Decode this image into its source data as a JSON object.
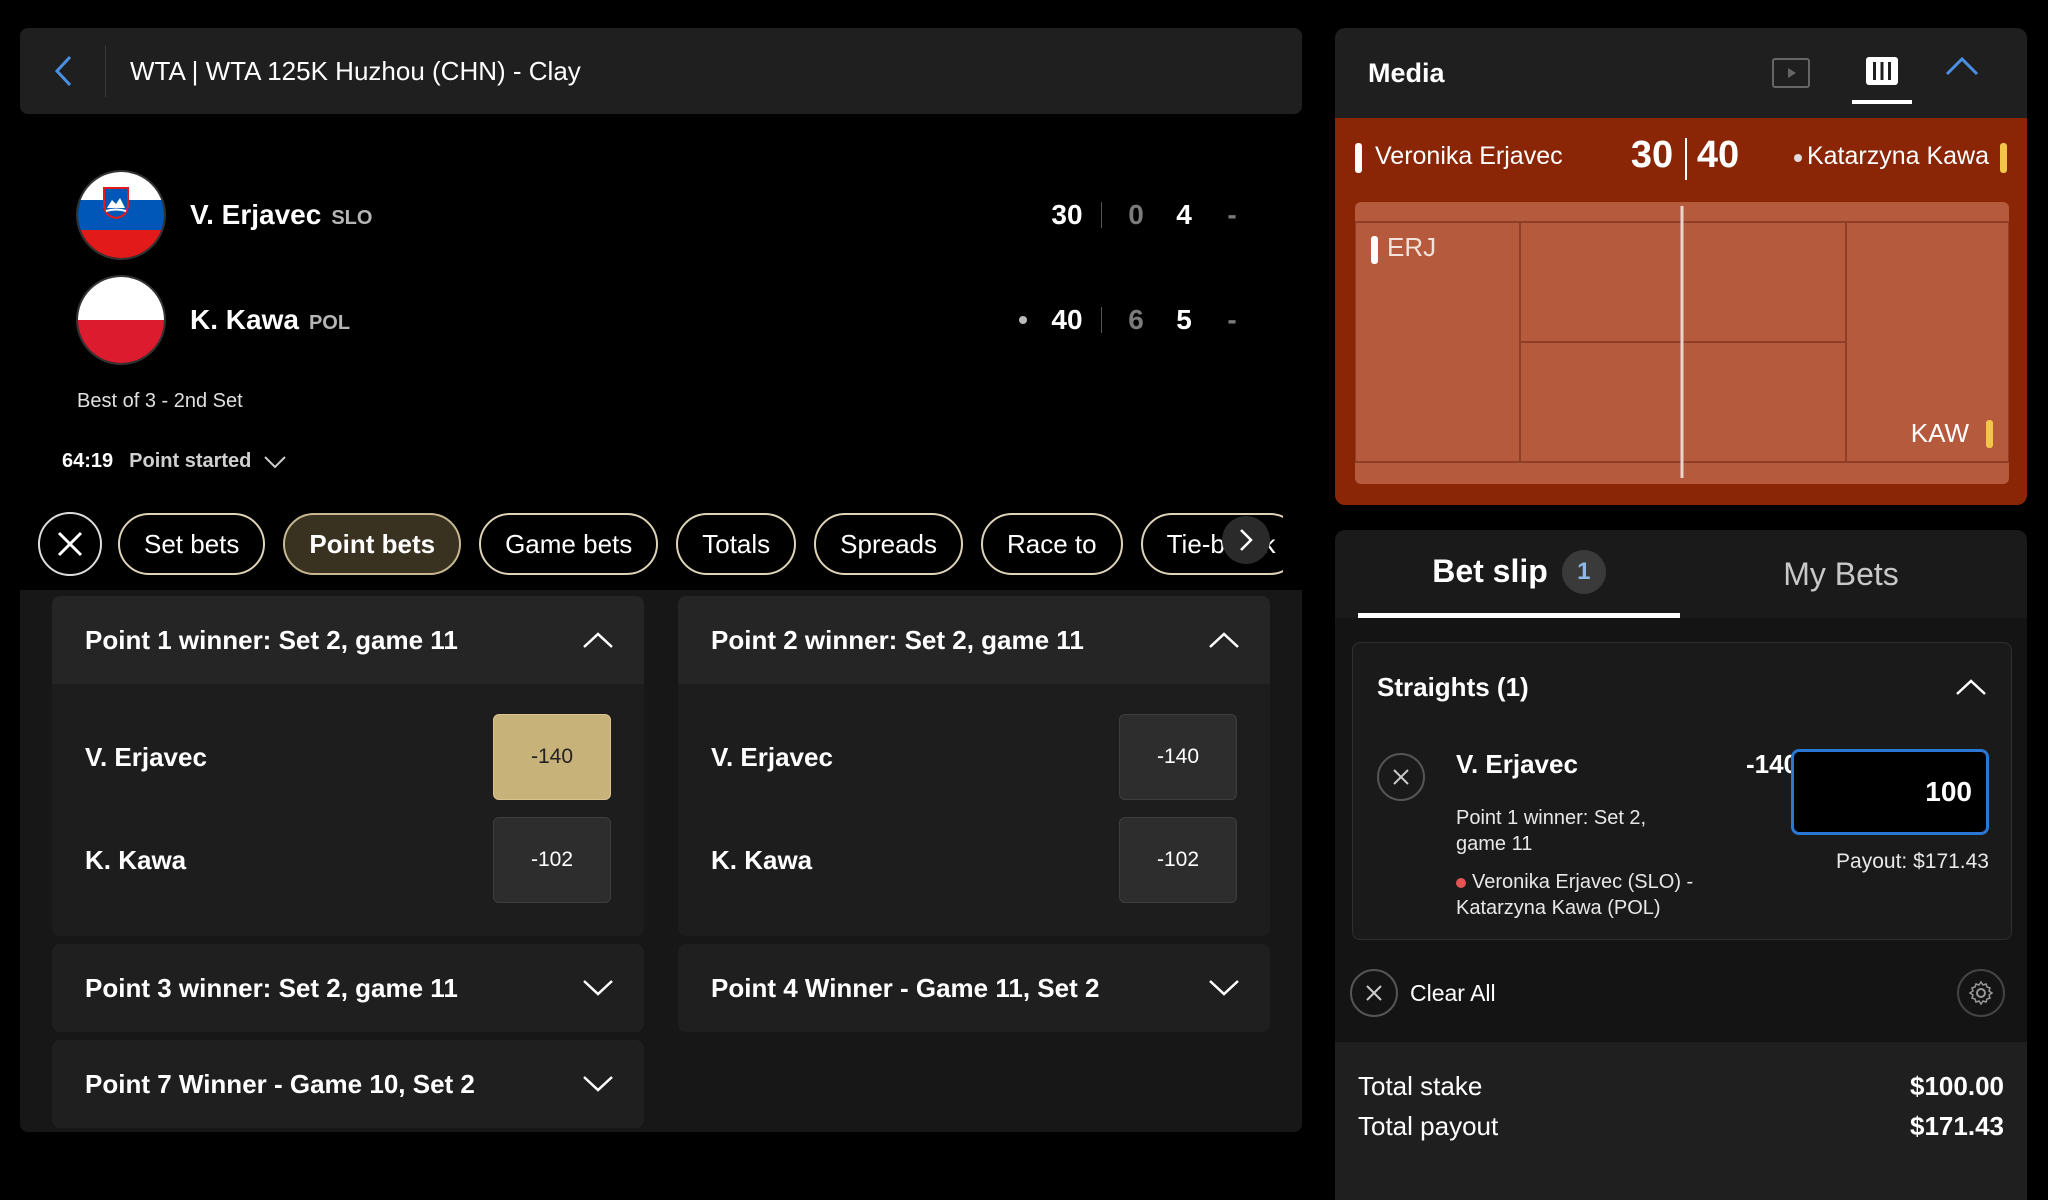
{
  "header": {
    "title": "WTA | WTA 125K Huzhou (CHN) - Clay"
  },
  "players": [
    {
      "short": "V. Erjavec",
      "country": "SLO",
      "points": "30",
      "set1": "0",
      "set2": "4",
      "set3": "-",
      "serving": false
    },
    {
      "short": "K. Kawa",
      "country": "POL",
      "points": "40",
      "set1": "6",
      "set2": "5",
      "set3": "-",
      "serving": true
    }
  ],
  "match": {
    "format": "Best of 3 - 2nd Set",
    "clock": "64:19",
    "status": "Point started"
  },
  "tabs": [
    "Set bets",
    "Point bets",
    "Game bets",
    "Totals",
    "Spreads",
    "Race to",
    "Tie-break"
  ],
  "active_tab": "Point bets",
  "markets": [
    {
      "title": "Point 1 winner: Set 2, game 11",
      "expanded": true,
      "selections": [
        {
          "name": "V. Erjavec",
          "odds": "-140",
          "selected": true
        },
        {
          "name": "K. Kawa",
          "odds": "-102",
          "selected": false
        }
      ]
    },
    {
      "title": "Point 2 winner: Set 2, game 11",
      "expanded": true,
      "selections": [
        {
          "name": "V. Erjavec",
          "odds": "-140",
          "selected": false
        },
        {
          "name": "K. Kawa",
          "odds": "-102",
          "selected": false
        }
      ]
    },
    {
      "title": "Point 3 winner: Set 2, game 11",
      "expanded": false
    },
    {
      "title": "Point 4 Winner - Game 11, Set 2",
      "expanded": false
    },
    {
      "title": "Point 7 Winner - Game 10, Set 2",
      "expanded": false
    }
  ],
  "media": {
    "title": "Media",
    "court": {
      "home_name": "Veronika Erjavec",
      "away_name": "Katarzyna Kawa",
      "home_pts": "30",
      "away_pts": "40",
      "home_abbr": "ERJ",
      "away_abbr": "KAW"
    }
  },
  "betslip": {
    "tab_label": "Bet slip",
    "count": "1",
    "mybets_label": "My Bets",
    "straights_label": "Straights (1)",
    "bet": {
      "player": "V. Erjavec",
      "odds": "-140",
      "market": "Point 1 winner: Set 2, game 11",
      "event": "Veronika Erjavec (SLO) - Katarzyna Kawa (POL)",
      "stake": "100",
      "payout": "Payout: $171.43"
    },
    "clear_all": "Clear All",
    "total_stake_label": "Total stake",
    "total_stake": "$100.00",
    "total_payout_label": "Total payout",
    "total_payout": "$171.43"
  },
  "colors": {
    "accent_selected": "#c7b27a",
    "court": "#b55a3c",
    "court_frame": "#8a2606",
    "input_focus": "#2a78d6"
  }
}
